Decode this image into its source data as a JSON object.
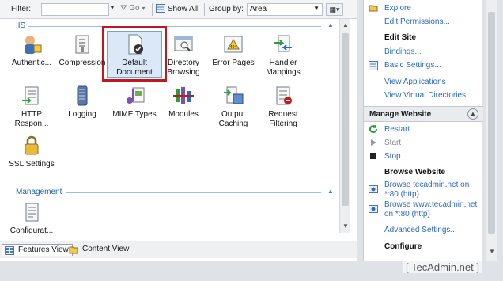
{
  "toolbar": {
    "filter_label": "Filter:",
    "filter_value": "",
    "go_label": "Go",
    "show_all_label": "Show All",
    "group_by_label": "Group by:",
    "group_by_value": "Area"
  },
  "sections": {
    "iis_title": "IIS",
    "management_title": "Management"
  },
  "features": {
    "authentication": "Authentic...",
    "compression": "Compression",
    "default_document": "Default Document",
    "directory_browsing": "Directory Browsing",
    "error_pages": "Error Pages",
    "handler_mappings": "Handler Mappings",
    "http_response": "HTTP Respon...",
    "logging": "Logging",
    "mime_types": "MIME Types",
    "modules": "Modules",
    "output_caching": "Output Caching",
    "request_filtering": "Request Filtering",
    "ssl_settings": "SSL Settings",
    "configuration": "Configurat..."
  },
  "tabs": {
    "features_view": "Features View",
    "content_view": "Content View"
  },
  "actions": {
    "explore": "Explore",
    "edit_permissions": "Edit Permissions...",
    "edit_site": "Edit Site",
    "bindings": "Bindings...",
    "basic_settings": "Basic Settings...",
    "view_applications": "View Applications",
    "view_virtual_directories": "View Virtual Directories",
    "manage_website": "Manage Website",
    "restart": "Restart",
    "start": "Start",
    "stop": "Stop",
    "browse_website": "Browse Website",
    "browse_tecadmin": "Browse tecadmin.net on *:80 (http)",
    "browse_www": "Browse www.tecadmin.net on *:80 (http)",
    "advanced_settings": "Advanced Settings...",
    "configure": "Configure"
  },
  "watermark": "[ TecAdmin.net ]",
  "colors": {
    "link": "#2a69c0",
    "highlight_box": "#c4171c",
    "section_header": "#1c5fa8"
  }
}
